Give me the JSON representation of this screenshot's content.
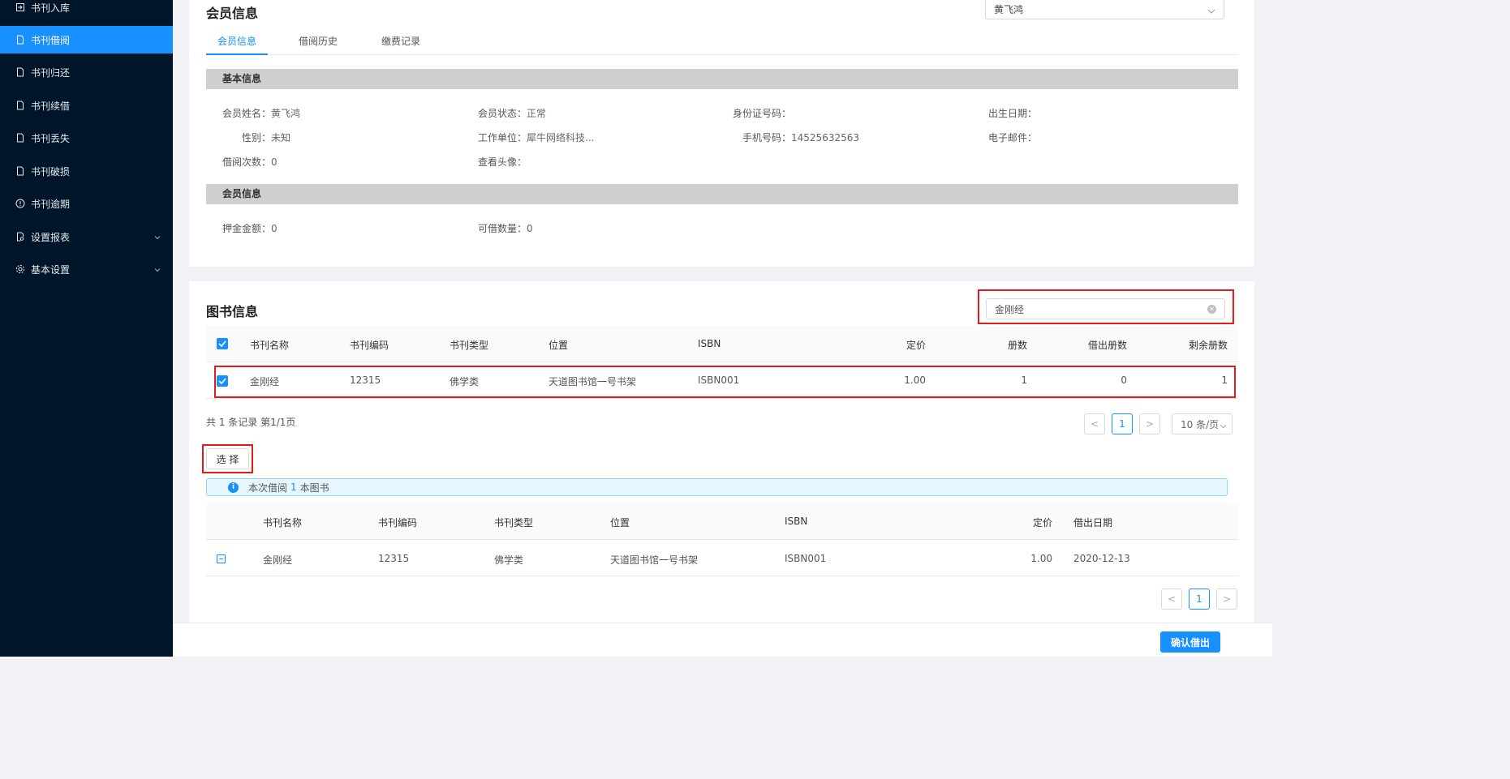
{
  "sidebar": {
    "items": [
      {
        "label": "书刊入库",
        "icon": "login-icon"
      },
      {
        "label": "书刊借阅",
        "icon": "file-icon",
        "active": true
      },
      {
        "label": "书刊归还",
        "icon": "file-icon"
      },
      {
        "label": "书刊续借",
        "icon": "file-icon"
      },
      {
        "label": "书刊丢失",
        "icon": "file-icon"
      },
      {
        "label": "书刊破损",
        "icon": "file-icon"
      },
      {
        "label": "书刊逾期",
        "icon": "exclamation-circle-icon"
      },
      {
        "label": "设置报表",
        "icon": "file-search-icon",
        "expandable": true
      },
      {
        "label": "基本设置",
        "icon": "gear-icon",
        "expandable": true
      }
    ]
  },
  "member": {
    "title": "会员信息",
    "selected_member": "黄飞鸿",
    "tabs": [
      "会员信息",
      "借阅历史",
      "缴费记录"
    ],
    "basic_section": "基本信息",
    "fields": {
      "name_label": "会员姓名：",
      "name": "黄飞鸿",
      "status_label": "会员状态：",
      "status": "正常",
      "id_label": "身份证号码：",
      "id": "",
      "birth_label": "出生日期：",
      "birth": "",
      "gender_label": "性别：",
      "gender": "未知",
      "work_label": "工作单位：",
      "work": "犀牛网络科技...",
      "phone_label": "手机号码：",
      "phone": "14525632563",
      "email_label": "电子邮件：",
      "email": "",
      "borrow_count_label": "借阅次数：",
      "borrow_count": "0",
      "avatar_label": "查看头像：",
      "avatar": ""
    },
    "member_section": "会员信息",
    "deposit_label": "押金金额：",
    "deposit": "0",
    "borrowable_label": "可借数量：",
    "borrowable": "0"
  },
  "books": {
    "title": "图书信息",
    "search_value": "金刚经",
    "columns": [
      "书刊名称",
      "书刊编码",
      "书刊类型",
      "位置",
      "ISBN",
      "定价",
      "册数",
      "借出册数",
      "剩余册数"
    ],
    "rows": [
      {
        "name": "金刚经",
        "code": "12315",
        "type": "佛学类",
        "location": "天道图书馆一号书架",
        "isbn": "ISBN001",
        "price": "1.00",
        "count": "1",
        "lent": "0",
        "remaining": "1"
      }
    ],
    "summary": "共 1 条记录 第1/1页",
    "page": "1",
    "page_size": "10 条/页",
    "select_button": "选 择"
  },
  "borrow": {
    "alert_prefix": "本次借阅",
    "alert_count": "1",
    "alert_suffix": "本图书",
    "columns": [
      "书刊名称",
      "书刊编码",
      "书刊类型",
      "位置",
      "ISBN",
      "定价",
      "借出日期"
    ],
    "rows": [
      {
        "name": "金刚经",
        "code": "12315",
        "type": "佛学类",
        "location": "天道图书馆一号书架",
        "isbn": "ISBN001",
        "price": "1.00",
        "date": "2020-12-13"
      }
    ],
    "page": "1",
    "confirm_button": "确认借出"
  },
  "colors": {
    "primary": "#1890ff",
    "sidebar": "#001529",
    "highlight": "#e41b1b"
  }
}
